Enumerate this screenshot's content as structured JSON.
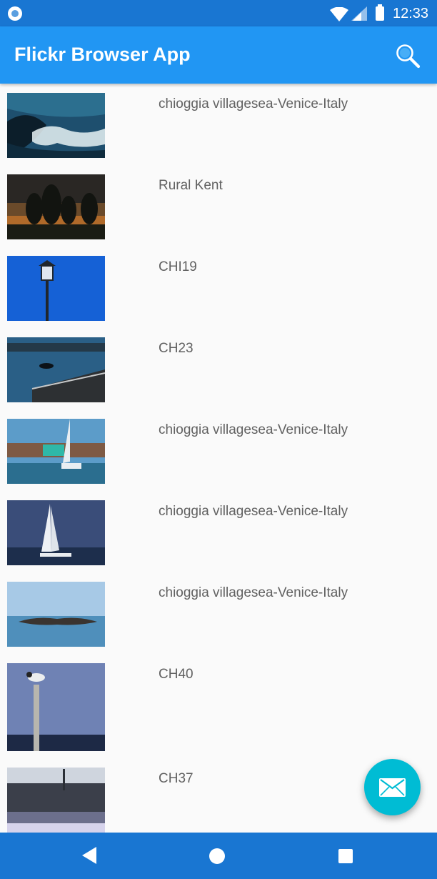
{
  "status_bar": {
    "time": "12:33"
  },
  "app_bar": {
    "title": "Flickr Browser App",
    "search_icon": "search-icon"
  },
  "photos": [
    {
      "title": "chioggia villagesea-Venice-Italy"
    },
    {
      "title": "Rural Kent"
    },
    {
      "title": "CHI19"
    },
    {
      "title": "CH23"
    },
    {
      "title": "chioggia villagesea-Venice-Italy"
    },
    {
      "title": "chioggia villagesea-Venice-Italy"
    },
    {
      "title": "chioggia villagesea-Venice-Italy"
    },
    {
      "title": "CH40"
    },
    {
      "title": "CH37"
    }
  ],
  "fab": {
    "icon": "mail-icon",
    "color": "#00bcd4"
  },
  "nav_bar": {
    "back_icon": "back-icon",
    "home_icon": "home-icon",
    "recents_icon": "recents-icon"
  },
  "colors": {
    "status_bar": "#1976d2",
    "app_bar": "#2196f3",
    "background": "#fafafa"
  }
}
